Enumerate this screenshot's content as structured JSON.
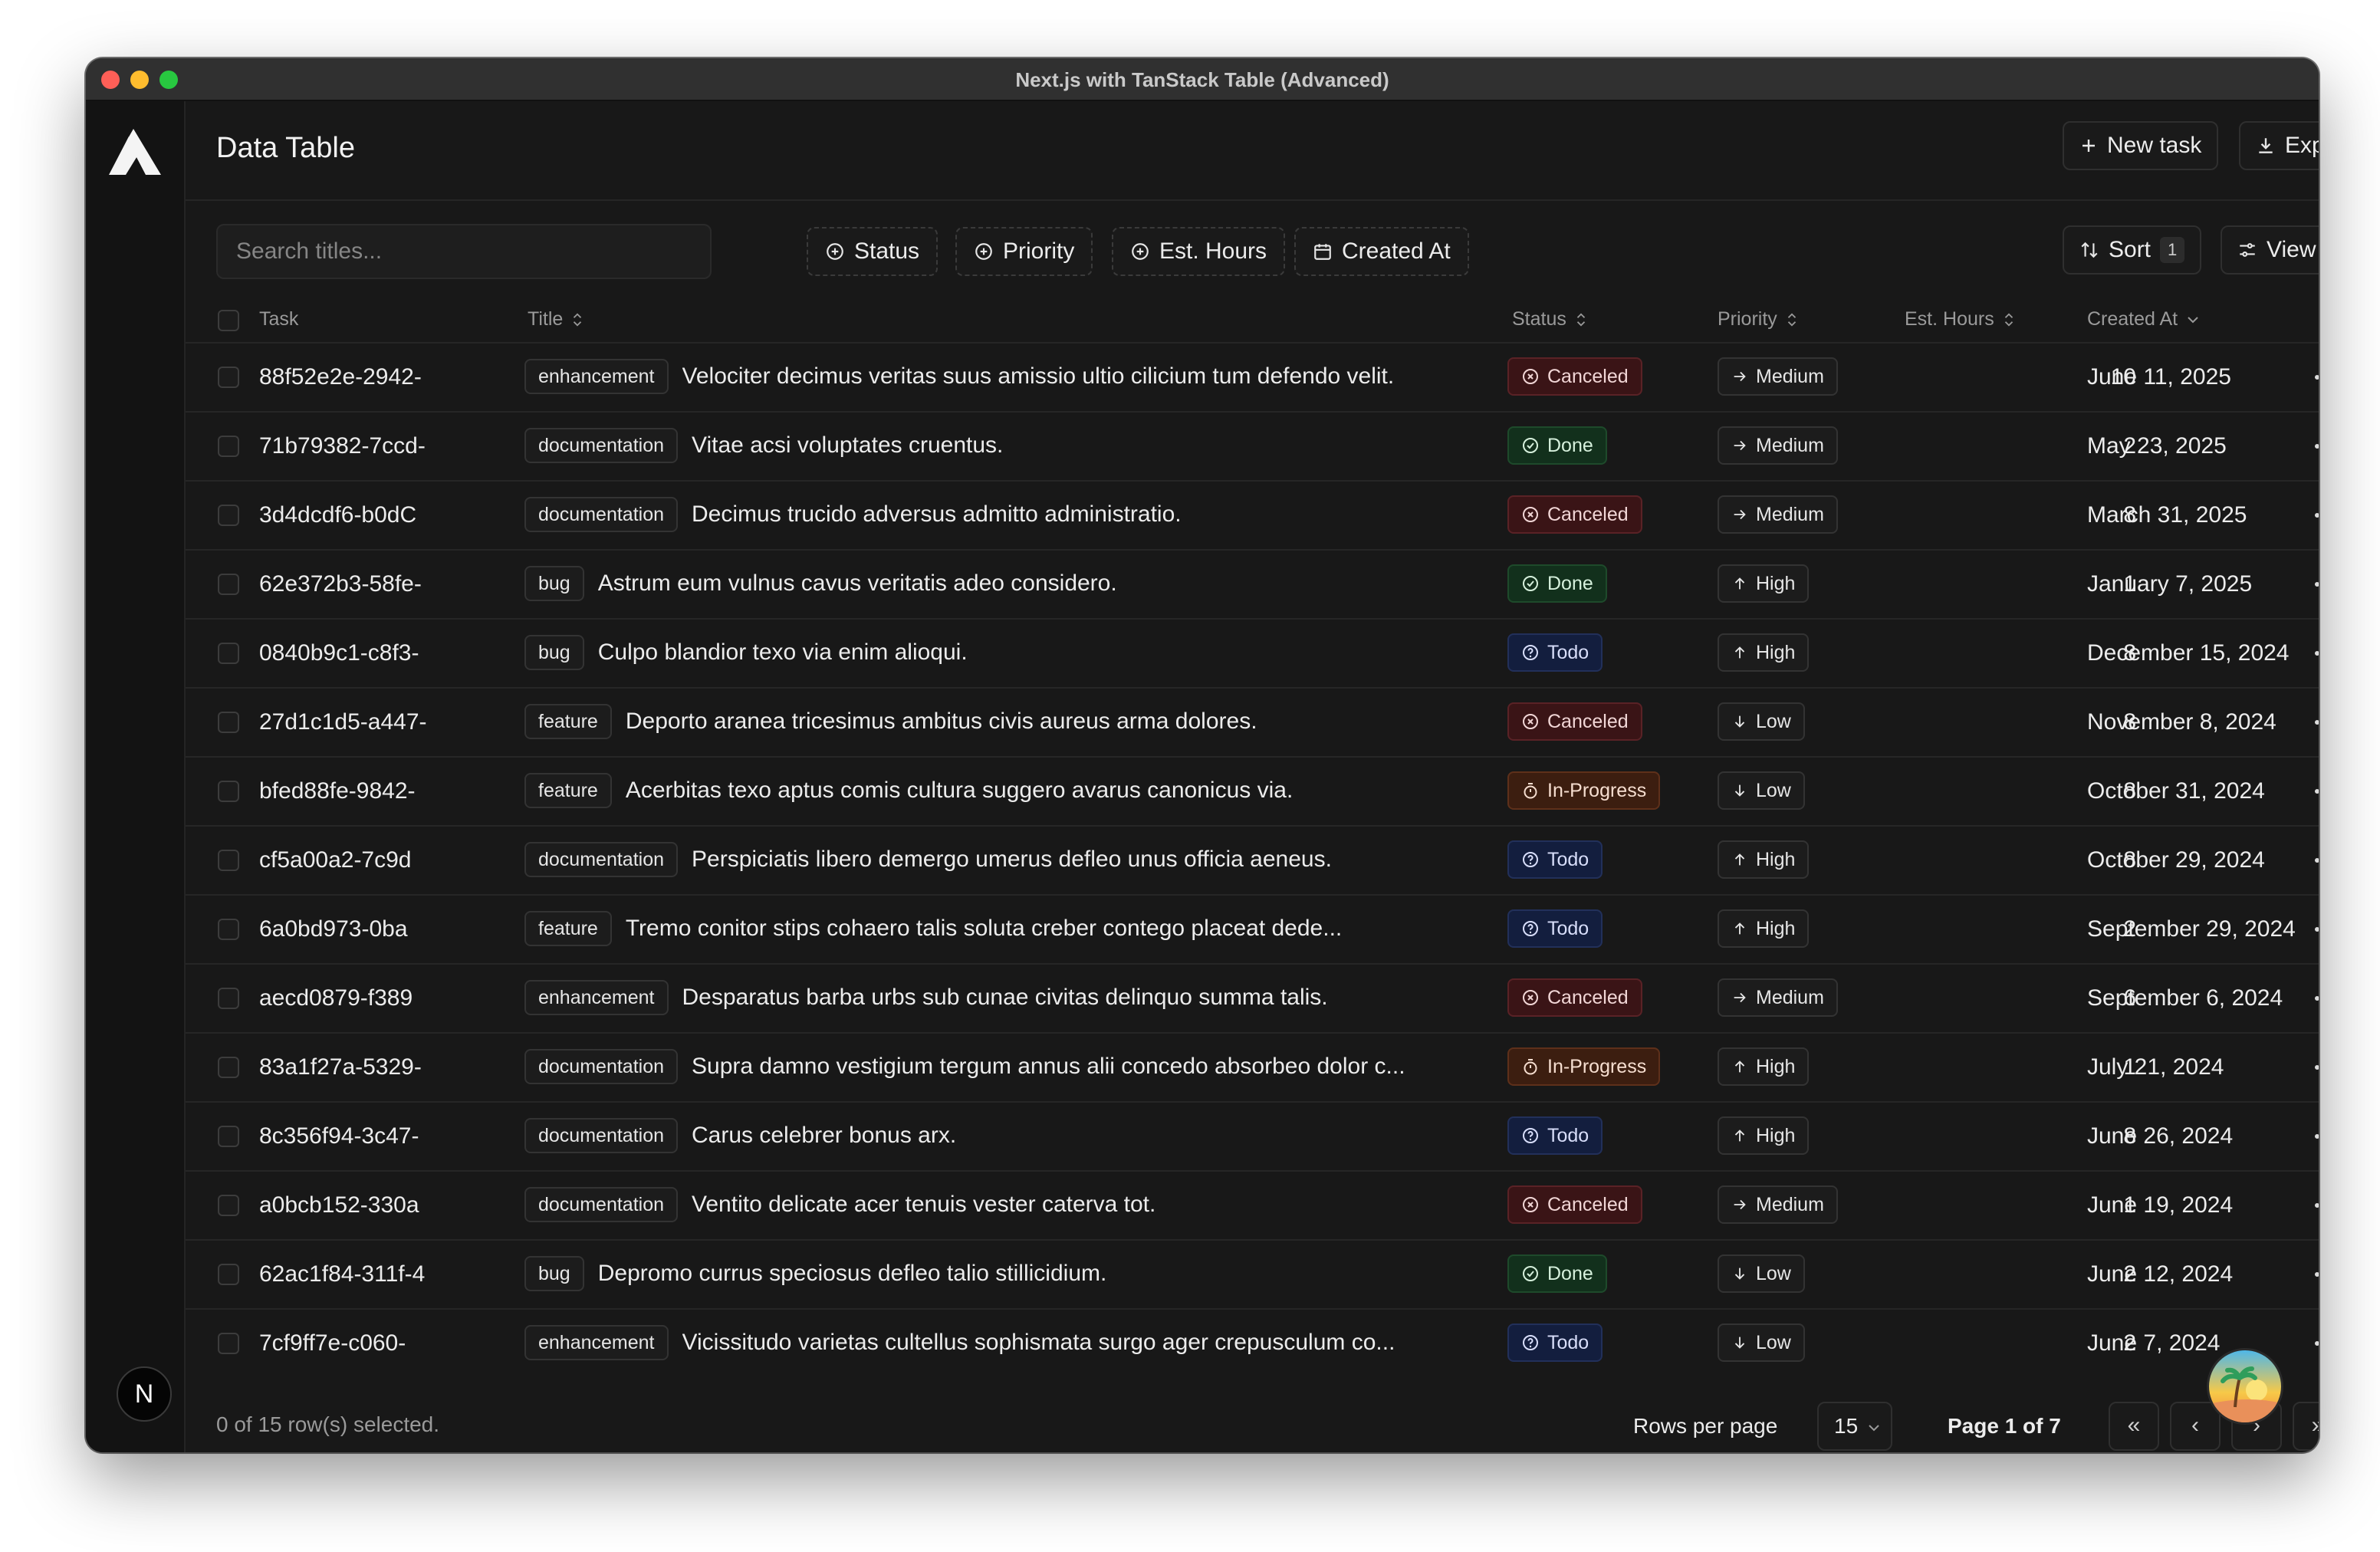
{
  "window": {
    "title": "Next.js with TanStack Table (Advanced)"
  },
  "sidebar": {
    "logo": "app-logo",
    "bottom_badge": "N"
  },
  "header": {
    "title": "Data Table",
    "new_task_label": "New task",
    "export_label": "Export"
  },
  "toolbar": {
    "search_placeholder": "Search titles...",
    "filters": [
      "Status",
      "Priority",
      "Est. Hours",
      "Created At"
    ],
    "sort_label": "Sort",
    "sort_count": "1",
    "view_label": "View"
  },
  "columns": {
    "task": "Task",
    "title": "Title",
    "status": "Status",
    "priority": "Priority",
    "hours": "Est. Hours",
    "created": "Created At"
  },
  "status_colors": {
    "Canceled": "#f1d6d6",
    "Done": "#d6f0dc",
    "Todo": "#d8defa",
    "In-Progress": "#f6ded0"
  },
  "rows": [
    {
      "task": "88f52e2e-2942-",
      "label": "enhancement",
      "title": "Velociter decimus veritas suus amissio ultio cilicium tum defendo velit.",
      "status": "Canceled",
      "priority": "Medium",
      "hours": "10",
      "created": "June 11, 2025"
    },
    {
      "task": "71b79382-7ccd-",
      "label": "documentation",
      "title": "Vitae acsi voluptates cruentus.",
      "status": "Done",
      "priority": "Medium",
      "hours": "2",
      "created": "May 23, 2025"
    },
    {
      "task": "3d4dcdf6-b0dC",
      "label": "documentation",
      "title": "Decimus trucido adversus admitto administratio.",
      "status": "Canceled",
      "priority": "Medium",
      "hours": "8",
      "created": "March 31, 2025"
    },
    {
      "task": "62e372b3-58fe-",
      "label": "bug",
      "title": "Astrum eum vulnus cavus veritatis adeo considero.",
      "status": "Done",
      "priority": "High",
      "hours": "1",
      "created": "January 7, 2025"
    },
    {
      "task": "0840b9c1-c8f3-",
      "label": "bug",
      "title": "Culpo blandior texo via enim alioqui.",
      "status": "Todo",
      "priority": "High",
      "hours": "8",
      "created": "December 15, 2024"
    },
    {
      "task": "27d1c1d5-a447-",
      "label": "feature",
      "title": "Deporto aranea tricesimus ambitus civis aureus arma dolores.",
      "status": "Canceled",
      "priority": "Low",
      "hours": "8",
      "created": "November 8, 2024"
    },
    {
      "task": "bfed88fe-9842-",
      "label": "feature",
      "title": "Acerbitas texo aptus comis cultura suggero avarus canonicus via.",
      "status": "In-Progress",
      "priority": "Low",
      "hours": "8",
      "created": "October 31, 2024"
    },
    {
      "task": "cf5a00a2-7c9d",
      "label": "documentation",
      "title": "Perspiciatis libero demergo umerus defleo unus officia aeneus.",
      "status": "Todo",
      "priority": "High",
      "hours": "8",
      "created": "October 29, 2024"
    },
    {
      "task": "6a0bd973-0ba",
      "label": "feature",
      "title": "Tremo conitor stips cohaero talis soluta creber contego placeat dede...",
      "status": "Todo",
      "priority": "High",
      "hours": "2",
      "created": "September 29, 2024"
    },
    {
      "task": "aecd0879-f389",
      "label": "enhancement",
      "title": "Desparatus barba urbs sub cunae civitas delinquo summa talis.",
      "status": "Canceled",
      "priority": "Medium",
      "hours": "6",
      "created": "September 6, 2024"
    },
    {
      "task": "83a1f27a-5329-",
      "label": "documentation",
      "title": "Supra damno vestigium tergum annus alii concedo absorbeo dolor c...",
      "status": "In-Progress",
      "priority": "High",
      "hours": "1",
      "created": "July 21, 2024"
    },
    {
      "task": "8c356f94-3c47-",
      "label": "documentation",
      "title": "Carus celebrer bonus arx.",
      "status": "Todo",
      "priority": "High",
      "hours": "8",
      "created": "June 26, 2024"
    },
    {
      "task": "a0bcb152-330a",
      "label": "documentation",
      "title": "Ventito delicate acer tenuis vester caterva tot.",
      "status": "Canceled",
      "priority": "Medium",
      "hours": "1",
      "created": "June 19, 2024"
    },
    {
      "task": "62ac1f84-311f-4",
      "label": "bug",
      "title": "Depromo currus speciosus defleo talio stillicidium.",
      "status": "Done",
      "priority": "Low",
      "hours": "2",
      "created": "June 12, 2024"
    },
    {
      "task": "7cf9ff7e-c060-",
      "label": "enhancement",
      "title": "Vicissitudo varietas cultellus sophismata surgo ager crepusculum co...",
      "status": "Todo",
      "priority": "Low",
      "hours": "2",
      "created": "June 7, 2024"
    }
  ],
  "footer": {
    "selection": "0 of 15 row(s) selected.",
    "rows_per_page_label": "Rows per page",
    "rows_per_page_value": "15",
    "page_indicator": "Page 1 of 7"
  }
}
